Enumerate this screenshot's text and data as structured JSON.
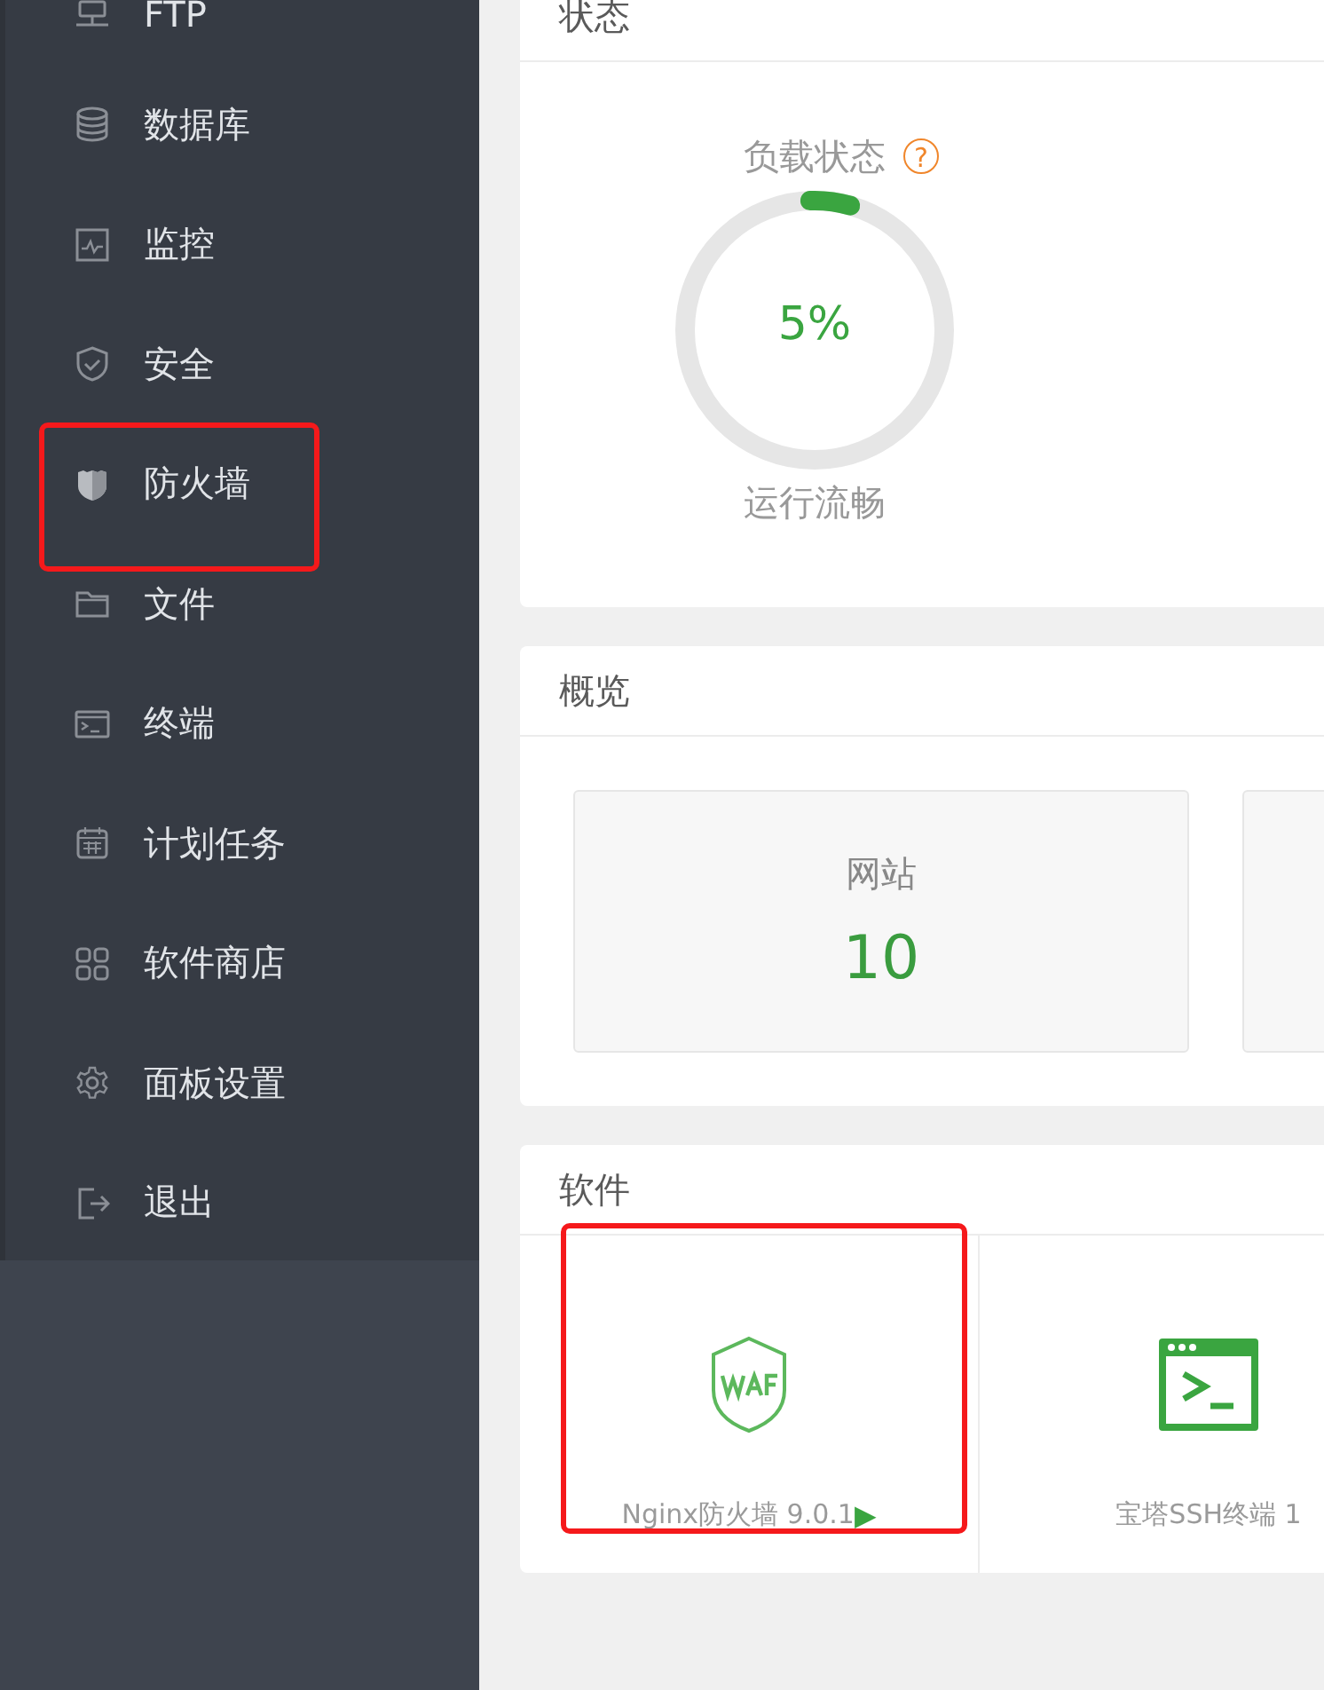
{
  "sidebar": {
    "items": [
      {
        "label": "FTP",
        "highlighted": false
      },
      {
        "label": "数据库",
        "highlighted": false
      },
      {
        "label": "监控",
        "highlighted": false
      },
      {
        "label": "安全",
        "highlighted": false
      },
      {
        "label": "防火墙",
        "highlighted": true
      },
      {
        "label": "文件",
        "highlighted": false
      },
      {
        "label": "终端",
        "highlighted": false
      },
      {
        "label": "计划任务",
        "highlighted": false
      },
      {
        "label": "软件商店",
        "highlighted": false
      },
      {
        "label": "面板设置",
        "highlighted": false
      },
      {
        "label": "退出",
        "highlighted": false
      }
    ]
  },
  "status": {
    "title": "状态",
    "gauge": {
      "title": "负载状态",
      "help": "?",
      "level": 0.05,
      "value": "5%",
      "caption": "运行流畅"
    }
  },
  "overview": {
    "title": "概览",
    "stats": [
      {
        "label": "网站",
        "value": "10"
      }
    ]
  },
  "software": {
    "title": "软件",
    "items": [
      {
        "kind": "waf",
        "label": "Nginx防火墙 9.0.1",
        "play": "▶",
        "highlighted": true
      },
      {
        "kind": "terminal",
        "label": "宝塔SSH终端 1",
        "highlighted": false
      }
    ]
  }
}
